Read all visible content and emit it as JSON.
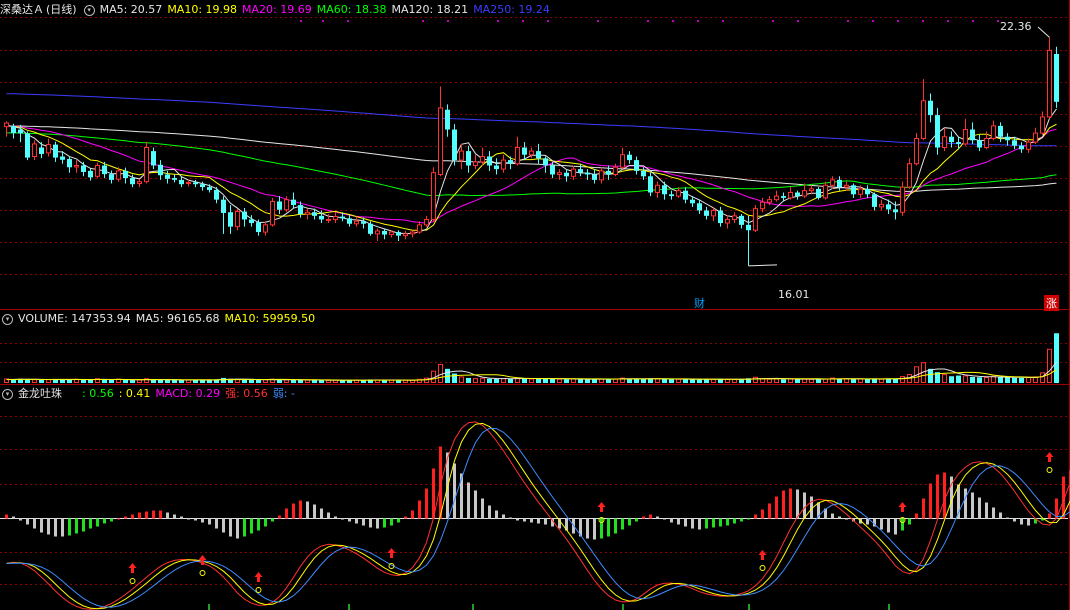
{
  "panels": {
    "price": {
      "stock_name": "深桑达Ａ",
      "period": "(日线)",
      "indicators": [
        {
          "label": "MA5: 20.57",
          "color": "#e6e6e6"
        },
        {
          "label": "MA10: 19.98",
          "color": "#ffff00"
        },
        {
          "label": "MA20: 19.69",
          "color": "#ff00ff"
        },
        {
          "label": "MA60: 18.38",
          "color": "#00ff00"
        },
        {
          "label": "MA120: 18.21",
          "color": "#e6e6e6"
        },
        {
          "label": "MA250: 19.24",
          "color": "#3c3cff"
        }
      ],
      "high_label": "22.36",
      "low_label": "16.01",
      "event_tags": [
        {
          "text": "财",
          "color": "#00a0ff"
        },
        {
          "text": "涨",
          "color": "#ffffff",
          "bg": "#d00000"
        }
      ]
    },
    "volume": {
      "indicators": [
        {
          "label": "VOLUME: 147353.94",
          "color": "#e6e6e6"
        },
        {
          "label": "MA5: 96165.68",
          "color": "#e6e6e6"
        },
        {
          "label": "MA10: 59959.50",
          "color": "#ffff00"
        }
      ]
    },
    "macd": {
      "name": "金龙吐珠",
      "indicators": [
        {
          "label": ": 0.56",
          "color": "#00ff00"
        },
        {
          "label": ": 0.41",
          "color": "#ffff00"
        },
        {
          "label": "MACD: 0.29",
          "color": "#ff00ff"
        },
        {
          "label": "强: 0.56",
          "color": "#ff3030"
        },
        {
          "label": "弱: -",
          "color": "#3c8cff"
        }
      ]
    }
  },
  "colors": {
    "up": "#ff3232",
    "down": "#54ffff",
    "ma5": "#e6e6e6",
    "ma10": "#ffff00",
    "ma20": "#ff00ff",
    "ma60": "#00ff00",
    "ma120": "#e6e6e6",
    "ma250": "#3c3cff",
    "grid": "#8b0000",
    "hist_pos": "#ff2020",
    "hist_neg": "#c8c8c8",
    "hist_green": "#20e020"
  },
  "chart_data": [
    {
      "type": "candlestick",
      "title": "深桑达Ａ (日线)",
      "y_range": [
        15.2,
        22.9
      ],
      "candles": [
        [
          19.88,
          19.98,
          20.03,
          19.6
        ],
        [
          19.9,
          19.7,
          19.96,
          19.55
        ],
        [
          19.8,
          19.69,
          19.93,
          19.45
        ],
        [
          19.69,
          19.02,
          19.75,
          18.95
        ],
        [
          19.05,
          19.4,
          19.5,
          18.95
        ],
        [
          19.3,
          19.12,
          19.45,
          19.0
        ],
        [
          19.15,
          19.38,
          19.55,
          19.05
        ],
        [
          19.38,
          19.02,
          19.46,
          18.9
        ],
        [
          19.05,
          18.96,
          19.2,
          18.85
        ],
        [
          18.98,
          18.75,
          19.05,
          18.6
        ],
        [
          18.76,
          18.8,
          18.95,
          18.6
        ],
        [
          18.8,
          18.62,
          18.9,
          18.5
        ],
        [
          18.65,
          18.47,
          18.72,
          18.38
        ],
        [
          18.5,
          18.8,
          18.88,
          18.45
        ],
        [
          18.8,
          18.56,
          18.9,
          18.45
        ],
        [
          18.56,
          18.4,
          18.66,
          18.3
        ],
        [
          18.42,
          18.65,
          18.75,
          18.35
        ],
        [
          18.65,
          18.45,
          18.74,
          18.3
        ],
        [
          18.45,
          18.28,
          18.55,
          18.2
        ],
        [
          18.3,
          18.35,
          18.42,
          18.2
        ],
        [
          18.35,
          19.3,
          19.45,
          18.3
        ],
        [
          19.2,
          18.8,
          19.3,
          18.7
        ],
        [
          18.82,
          18.53,
          18.95,
          18.4
        ],
        [
          18.55,
          18.43,
          18.65,
          18.3
        ],
        [
          18.45,
          18.4,
          18.55,
          18.33
        ],
        [
          18.4,
          18.28,
          18.5,
          18.2
        ],
        [
          18.3,
          18.33,
          18.4,
          18.22
        ],
        [
          18.33,
          18.28,
          18.4,
          18.2
        ],
        [
          18.28,
          18.2,
          18.35,
          18.1
        ],
        [
          18.2,
          18.12,
          18.28,
          18.05
        ],
        [
          18.12,
          17.85,
          18.2,
          17.75
        ],
        [
          17.85,
          17.48,
          17.95,
          16.9
        ],
        [
          17.5,
          17.1,
          17.7,
          16.9
        ],
        [
          17.1,
          17.52,
          17.6,
          17.0
        ],
        [
          17.52,
          17.3,
          17.62,
          17.1
        ],
        [
          17.3,
          17.2,
          17.42,
          17.1
        ],
        [
          17.22,
          16.95,
          17.3,
          16.85
        ],
        [
          16.95,
          17.15,
          17.25,
          16.85
        ],
        [
          17.15,
          17.8,
          17.9,
          17.1
        ],
        [
          17.8,
          17.57,
          17.95,
          17.45
        ],
        [
          17.57,
          17.85,
          17.95,
          17.5
        ],
        [
          17.85,
          17.7,
          18.05,
          17.6
        ],
        [
          17.7,
          17.45,
          17.8,
          17.35
        ],
        [
          17.45,
          17.5,
          17.6,
          17.3
        ],
        [
          17.5,
          17.4,
          17.6,
          17.3
        ],
        [
          17.4,
          17.3,
          17.55,
          17.2
        ],
        [
          17.3,
          17.3,
          17.45,
          17.2
        ],
        [
          17.3,
          17.38,
          17.5,
          17.2
        ],
        [
          17.38,
          17.33,
          17.5,
          17.25
        ],
        [
          17.33,
          17.18,
          17.42,
          17.1
        ],
        [
          17.18,
          17.25,
          17.38,
          17.1
        ],
        [
          17.25,
          17.18,
          17.35,
          17.05
        ],
        [
          17.18,
          16.9,
          17.25,
          16.85
        ],
        [
          16.9,
          16.98,
          17.05,
          16.7
        ],
        [
          16.98,
          16.88,
          17.05,
          16.75
        ],
        [
          16.88,
          16.95,
          17.0,
          16.8
        ],
        [
          16.95,
          16.85,
          17.0,
          16.7
        ],
        [
          16.85,
          16.9,
          16.98,
          16.75
        ],
        [
          16.9,
          16.95,
          17.0,
          16.8
        ],
        [
          16.95,
          17.15,
          17.25,
          16.9
        ],
        [
          17.15,
          17.3,
          17.4,
          17.1
        ],
        [
          17.3,
          18.6,
          18.75,
          17.25
        ],
        [
          18.55,
          20.4,
          21.0,
          18.5
        ],
        [
          20.35,
          19.8,
          20.5,
          19.6
        ],
        [
          19.8,
          18.95,
          19.95,
          18.8
        ],
        [
          18.95,
          19.2,
          19.4,
          18.7
        ],
        [
          19.2,
          18.8,
          19.35,
          18.6
        ],
        [
          18.8,
          18.9,
          19.1,
          18.7
        ],
        [
          18.9,
          19.05,
          19.3,
          18.8
        ],
        [
          19.05,
          18.8,
          19.2,
          18.65
        ],
        [
          18.8,
          18.7,
          19.0,
          18.55
        ],
        [
          18.7,
          18.95,
          19.1,
          18.6
        ],
        [
          18.95,
          18.85,
          19.05,
          18.7
        ],
        [
          18.85,
          19.3,
          19.6,
          18.8
        ],
        [
          19.3,
          19.1,
          19.45,
          18.95
        ],
        [
          19.1,
          19.2,
          19.3,
          19.0
        ],
        [
          19.2,
          19.0,
          19.4,
          18.85
        ],
        [
          19.0,
          18.8,
          19.05,
          18.6
        ],
        [
          18.8,
          18.55,
          18.9,
          18.45
        ],
        [
          18.55,
          18.6,
          18.7,
          18.4
        ],
        [
          18.6,
          18.5,
          18.7,
          18.35
        ],
        [
          18.5,
          18.7,
          18.8,
          18.4
        ],
        [
          18.7,
          18.6,
          18.85,
          18.5
        ],
        [
          18.6,
          18.55,
          18.7,
          18.4
        ],
        [
          18.55,
          18.4,
          18.7,
          18.3
        ],
        [
          18.4,
          18.65,
          18.75,
          18.3
        ],
        [
          18.65,
          18.55,
          18.8,
          18.4
        ],
        [
          18.55,
          18.75,
          18.85,
          18.5
        ],
        [
          18.75,
          19.1,
          19.3,
          18.7
        ],
        [
          19.1,
          18.95,
          19.2,
          18.85
        ],
        [
          18.95,
          18.65,
          19.05,
          18.55
        ],
        [
          18.65,
          18.5,
          18.75,
          18.4
        ],
        [
          18.5,
          18.05,
          18.6,
          17.95
        ],
        [
          18.05,
          18.25,
          18.35,
          17.9
        ],
        [
          18.25,
          18.0,
          18.35,
          17.85
        ],
        [
          18.0,
          17.95,
          18.1,
          17.85
        ],
        [
          17.95,
          18.1,
          18.2,
          17.9
        ],
        [
          18.1,
          17.85,
          18.2,
          17.75
        ],
        [
          17.85,
          17.75,
          17.95,
          17.65
        ],
        [
          17.75,
          17.55,
          17.85,
          17.45
        ],
        [
          17.55,
          17.4,
          17.65,
          17.3
        ],
        [
          17.4,
          17.55,
          17.65,
          17.25
        ],
        [
          17.55,
          17.2,
          17.65,
          17.1
        ],
        [
          17.2,
          17.3,
          17.42,
          17.05
        ],
        [
          17.3,
          17.4,
          17.5,
          17.2
        ],
        [
          17.4,
          17.15,
          17.45,
          17.05
        ],
        [
          17.15,
          17.0,
          17.4,
          16.01
        ],
        [
          17.0,
          17.6,
          17.7,
          16.95
        ],
        [
          17.6,
          17.78,
          17.9,
          17.5
        ],
        [
          17.78,
          17.85,
          17.95,
          17.7
        ],
        [
          17.85,
          17.95,
          18.1,
          17.8
        ],
        [
          17.95,
          17.9,
          18.05,
          17.8
        ],
        [
          17.9,
          18.05,
          18.2,
          17.85
        ],
        [
          18.05,
          17.95,
          18.1,
          17.85
        ],
        [
          17.95,
          18.1,
          18.3,
          17.9
        ],
        [
          18.1,
          18.15,
          18.25,
          18.0
        ],
        [
          18.15,
          17.9,
          18.2,
          17.85
        ],
        [
          17.9,
          18.25,
          18.35,
          17.85
        ],
        [
          18.25,
          18.4,
          18.5,
          18.15
        ],
        [
          18.4,
          18.2,
          18.5,
          18.1
        ],
        [
          18.2,
          18.25,
          18.35,
          18.1
        ],
        [
          18.25,
          18.0,
          18.3,
          17.9
        ],
        [
          18.0,
          18.15,
          18.25,
          17.9
        ],
        [
          18.15,
          18.0,
          18.25,
          17.9
        ],
        [
          18.0,
          17.65,
          18.05,
          17.55
        ],
        [
          17.65,
          17.72,
          17.85,
          17.55
        ],
        [
          17.72,
          17.58,
          17.85,
          17.45
        ],
        [
          17.58,
          17.5,
          17.8,
          17.3
        ],
        [
          17.5,
          18.2,
          18.35,
          17.4
        ],
        [
          18.2,
          18.85,
          19.0,
          18.15
        ],
        [
          18.85,
          19.55,
          19.7,
          18.8
        ],
        [
          19.55,
          20.6,
          21.2,
          19.5
        ],
        [
          20.6,
          20.2,
          20.8,
          20.0
        ],
        [
          20.2,
          19.3,
          20.4,
          19.1
        ],
        [
          19.3,
          19.6,
          19.85,
          19.2
        ],
        [
          19.6,
          19.45,
          19.75,
          19.3
        ],
        [
          19.45,
          19.4,
          19.6,
          19.25
        ],
        [
          19.4,
          19.8,
          20.1,
          19.35
        ],
        [
          19.8,
          19.5,
          20.0,
          19.4
        ],
        [
          19.5,
          19.3,
          19.65,
          19.2
        ],
        [
          19.3,
          19.55,
          19.75,
          19.25
        ],
        [
          19.55,
          19.9,
          20.05,
          19.5
        ],
        [
          19.9,
          19.6,
          20.0,
          19.45
        ],
        [
          19.6,
          19.5,
          19.7,
          19.35
        ],
        [
          19.5,
          19.35,
          19.6,
          19.25
        ],
        [
          19.35,
          19.25,
          19.45,
          19.15
        ],
        [
          19.25,
          19.45,
          19.55,
          19.15
        ],
        [
          19.45,
          19.7,
          19.85,
          19.4
        ],
        [
          19.7,
          20.15,
          20.3,
          19.65
        ],
        [
          20.15,
          22.0,
          22.36,
          20.1
        ],
        [
          21.9,
          20.57,
          22.1,
          20.4
        ]
      ]
    },
    {
      "type": "bar",
      "title": "VOLUME",
      "series_name": "VOLUME",
      "ylim": [
        0,
        160000
      ],
      "values": [
        12000,
        11000,
        12500,
        10500,
        10000,
        9000,
        10000,
        11500,
        9500,
        10500,
        11000,
        9800,
        10200,
        12500,
        10000,
        9500,
        11000,
        9000,
        8500,
        8800,
        12500,
        10500,
        9500,
        8800,
        9000,
        8500,
        8800,
        9000,
        8600,
        8200,
        11000,
        15000,
        12500,
        10500,
        9500,
        8800,
        9500,
        10000,
        11000,
        9500,
        9000,
        9800,
        9200,
        8600,
        8200,
        8400,
        8000,
        8300,
        8100,
        8400,
        8600,
        8200,
        10500,
        9000,
        8800,
        8400,
        8200,
        8500,
        8300,
        11000,
        14500,
        35000,
        55000,
        42000,
        28000,
        18000,
        15000,
        13000,
        14000,
        12500,
        12000,
        13000,
        12500,
        15000,
        13500,
        12000,
        14000,
        12500,
        13000,
        11500,
        11000,
        12000,
        11500,
        11000,
        12000,
        11500,
        12000,
        11800,
        14500,
        12500,
        12000,
        11000,
        14000,
        12500,
        11500,
        10500,
        11000,
        12000,
        11000,
        11500,
        11000,
        10500,
        12500,
        10200,
        10500,
        11200,
        14000,
        17000,
        13000,
        11500,
        12500,
        11000,
        12500,
        11000,
        12000,
        11000,
        11500,
        12000,
        14500,
        12000,
        12500,
        11500,
        12000,
        11500,
        13500,
        11000,
        12500,
        12000,
        19000,
        25000,
        48000,
        60000,
        42000,
        32000,
        25000,
        20000,
        22000,
        21000,
        18000,
        17000,
        16000,
        20000,
        18500,
        16500,
        15500,
        15000,
        16500,
        18000,
        30000,
        100000,
        147353.94
      ]
    },
    {
      "type": "line",
      "title": "金龙吐珠",
      "ylim": [
        -0.9,
        0.9
      ],
      "hist": [
        0.04,
        0.02,
        -0.02,
        -0.06,
        -0.1,
        -0.14,
        -0.16,
        -0.18,
        -0.18,
        -0.17,
        -0.15,
        -0.13,
        -0.1,
        -0.08,
        -0.05,
        -0.03,
        0.0,
        0.02,
        0.04,
        0.06,
        0.07,
        0.08,
        0.08,
        0.06,
        0.04,
        0.02,
        0.0,
        -0.02,
        -0.04,
        -0.06,
        -0.1,
        -0.14,
        -0.18,
        -0.2,
        -0.18,
        -0.15,
        -0.12,
        -0.08,
        -0.03,
        0.03,
        0.1,
        0.15,
        0.18,
        0.17,
        0.14,
        0.1,
        0.06,
        0.02,
        -0.01,
        -0.03,
        -0.05,
        -0.07,
        -0.09,
        -0.1,
        -0.09,
        -0.07,
        -0.04,
        0.02,
        0.08,
        0.18,
        0.3,
        0.5,
        0.72,
        0.66,
        0.55,
        0.45,
        0.36,
        0.28,
        0.2,
        0.13,
        0.08,
        0.04,
        0.01,
        -0.02,
        -0.03,
        -0.04,
        -0.05,
        -0.06,
        -0.08,
        -0.1,
        -0.12,
        -0.15,
        -0.18,
        -0.2,
        -0.21,
        -0.2,
        -0.18,
        -0.15,
        -0.11,
        -0.07,
        -0.03,
        0.02,
        0.04,
        0.02,
        -0.01,
        -0.04,
        -0.06,
        -0.08,
        -0.1,
        -0.11,
        -0.1,
        -0.09,
        -0.08,
        -0.07,
        -0.05,
        -0.03,
        -0.01,
        0.04,
        0.09,
        0.15,
        0.22,
        0.28,
        0.3,
        0.29,
        0.26,
        0.22,
        0.16,
        0.1,
        0.05,
        0.02,
        -0.01,
        -0.03,
        -0.05,
        -0.06,
        -0.08,
        -0.11,
        -0.14,
        -0.16,
        -0.12,
        -0.06,
        0.05,
        0.2,
        0.35,
        0.44,
        0.46,
        0.42,
        0.34,
        0.3,
        0.26,
        0.21,
        0.16,
        0.11,
        0.06,
        0.01,
        -0.03,
        -0.06,
        -0.07,
        -0.05,
        -0.02,
        0.05,
        0.2,
        0.42,
        0.48
      ]
    }
  ]
}
